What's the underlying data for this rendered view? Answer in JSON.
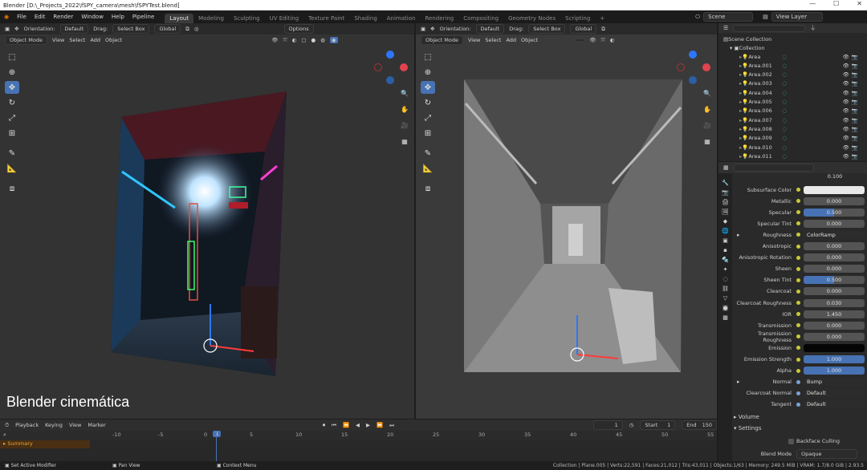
{
  "title_bar": {
    "text": "Blender [D:\\_Projects_2022\\fSPY_camera\\mesh\\fSPYTest.blend]",
    "min": "—",
    "max": "☐",
    "close": "✕"
  },
  "menu": [
    "File",
    "Edit",
    "Render",
    "Window",
    "Help",
    "Pipeline"
  ],
  "workspaces": [
    "Layout",
    "Modeling",
    "Sculpting",
    "UV Editing",
    "Texture Paint",
    "Shading",
    "Animation",
    "Rendering",
    "Compositing",
    "Geometry Nodes",
    "Scripting"
  ],
  "active_workspace": "Layout",
  "scene": {
    "label": "Scene",
    "view_layer": "View Layer"
  },
  "viewport_left": {
    "orientation_label": "Orientation:",
    "orientation": "Default",
    "drag_label": "Drag:",
    "drag": "Select Box",
    "transform": "Global",
    "options": "Options",
    "mode": "Object Mode",
    "menus": [
      "View",
      "Select",
      "Add",
      "Object"
    ]
  },
  "viewport_right": {
    "orientation_label": "Orientation:",
    "orientation": "Default",
    "drag_label": "Drag:",
    "drag": "Select Box",
    "transform": "Global",
    "mode": "Object Mode",
    "menus": [
      "View",
      "Select",
      "Add",
      "Object"
    ]
  },
  "overlay_text": "Blender cinemática",
  "outliner": {
    "root": "Scene Collection",
    "collection": "Collection",
    "items": [
      "Area",
      "Area.001",
      "Area.002",
      "Area.003",
      "Area.004",
      "Area.005",
      "Area.006",
      "Area.007",
      "Area.008",
      "Area.009",
      "Area.010",
      "Area.011"
    ]
  },
  "properties": {
    "top_value": "0.100",
    "rows": [
      {
        "label": "Subsurface Color",
        "value": "",
        "kind": "color-white"
      },
      {
        "label": "Metallic",
        "value": "0.000",
        "kind": "num"
      },
      {
        "label": "Specular",
        "value": "0.500",
        "kind": "bar",
        "fill": 0.5
      },
      {
        "label": "Specular Tint",
        "value": "0.000",
        "kind": "num"
      },
      {
        "label": "Roughness",
        "value": "ColorRamp",
        "kind": "link"
      },
      {
        "label": "Anisotropic",
        "value": "0.000",
        "kind": "num"
      },
      {
        "label": "Anisotropic Rotation",
        "value": "0.000",
        "kind": "num"
      },
      {
        "label": "Sheen",
        "value": "0.000",
        "kind": "num"
      },
      {
        "label": "Sheen Tint",
        "value": "0.500",
        "kind": "bar",
        "fill": 0.5
      },
      {
        "label": "Clearcoat",
        "value": "0.000",
        "kind": "num"
      },
      {
        "label": "Clearcoat Roughness",
        "value": "0.030",
        "kind": "num"
      },
      {
        "label": "IOR",
        "value": "1.450",
        "kind": "num"
      },
      {
        "label": "Transmission",
        "value": "0.000",
        "kind": "num"
      },
      {
        "label": "Transmission Roughness",
        "value": "0.000",
        "kind": "num"
      },
      {
        "label": "Emission",
        "value": "",
        "kind": "color-black"
      },
      {
        "label": "Emission Strength",
        "value": "1.000",
        "kind": "bar",
        "fill": 1
      },
      {
        "label": "Alpha",
        "value": "1.000",
        "kind": "bar",
        "fill": 1
      },
      {
        "label": "Normal",
        "value": "Bump",
        "kind": "link"
      },
      {
        "label": "Clearcoat Normal",
        "value": "Default",
        "kind": "text"
      },
      {
        "label": "Tangent",
        "value": "Default",
        "kind": "text"
      }
    ],
    "panels": [
      "Volume",
      "Settings"
    ],
    "backface": "Backface Culling",
    "blend_mode_label": "Blend Mode",
    "blend_mode": "Opaque"
  },
  "timeline": {
    "menus": [
      "Playback",
      "Keying",
      "View",
      "Marker"
    ],
    "current_frame": "1",
    "start_label": "Start",
    "start": "1",
    "end_label": "End",
    "end": "150",
    "summary": "Summary",
    "ticks": [
      "-10",
      "-5",
      "0",
      "5",
      "10",
      "15",
      "20",
      "25",
      "30",
      "35",
      "40",
      "45",
      "50",
      "55"
    ],
    "cursor_frame": "1"
  },
  "status": {
    "left": "Set Active Modifier",
    "mid": "Pan View",
    "right_hint": "Context Menu",
    "info": "Collection | Plane.005 | Verts:22,591 | Faces:21,012 | Tris:43,011 | Objects:1/63 | Memory: 249.5 MiB | VRAM: 1.7/8.0 GiB | 2.93.5"
  }
}
